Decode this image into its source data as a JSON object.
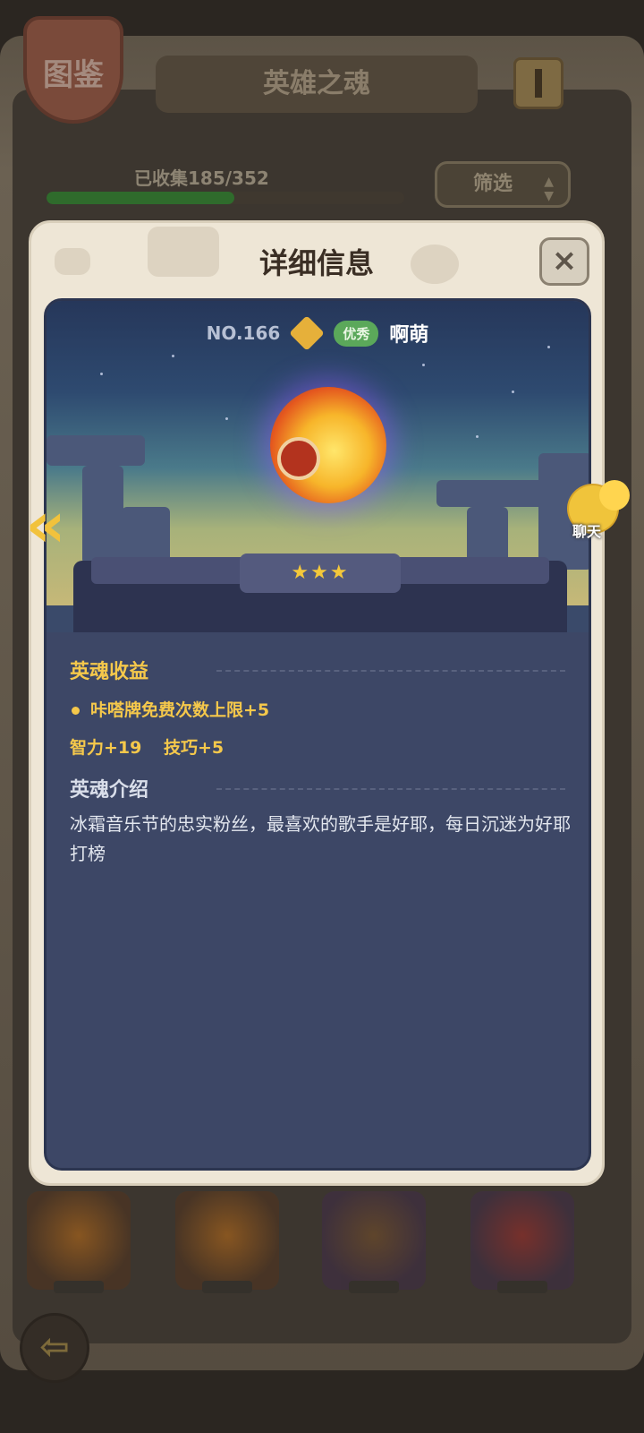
{
  "background": {
    "badge_label": "图鉴",
    "title": "英雄之魂",
    "collected_text": "已收集185/352",
    "collected_progress": 0.526,
    "filter_label": "筛选"
  },
  "modal": {
    "title": "详细信息",
    "close_label": "×",
    "hero": {
      "number": "NO.166",
      "quality": "优秀",
      "name": "啊萌",
      "stars": "★★★"
    },
    "benefit": {
      "title": "英魂收益",
      "bullet": "咔嗒牌免费次数上限+5",
      "stat1": "智力+19",
      "stat2": "技巧+5"
    },
    "intro": {
      "title": "英魂介绍",
      "text": "冰霜音乐节的忠实粉丝，最喜欢的歌手是好耶，每日沉迷为好耶打榜"
    }
  },
  "side": {
    "prev_arrow": "«",
    "chat_label": "聊天"
  },
  "bottom": {
    "back_arrow": "⇦"
  },
  "colors": {
    "accent_gold": "#f5c84b",
    "quality_green": "#5ba85a",
    "panel_blue": "#3d4766"
  }
}
